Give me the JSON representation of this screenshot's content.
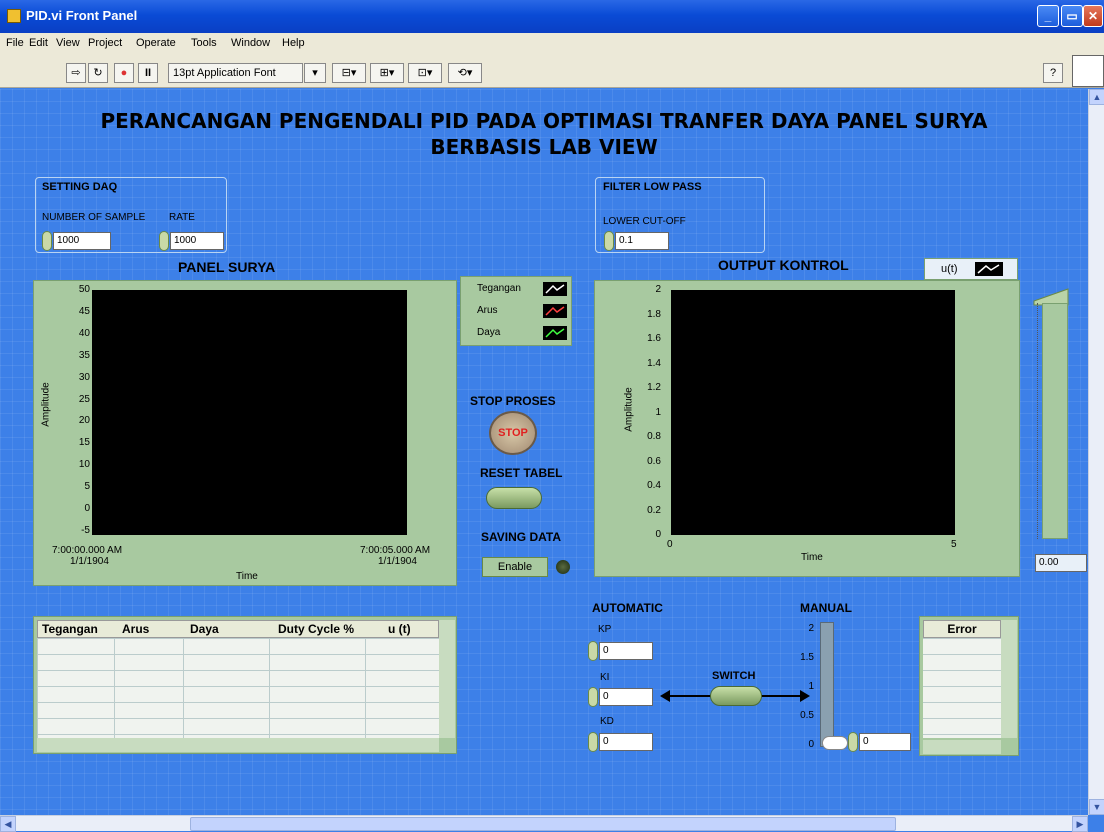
{
  "window": {
    "title": "PID.vi Front Panel"
  },
  "menu": [
    "File",
    "Edit",
    "View",
    "Project",
    "Operate",
    "Tools",
    "Window",
    "Help"
  ],
  "toolbar": {
    "font_select": "13pt Application Font"
  },
  "heading": {
    "line1": "PERANCANGAN PENGENDALI PID PADA OPTIMASI TRANFER DAYA PANEL SURYA",
    "line2": "BERBASIS LAB VIEW"
  },
  "setting_daq": {
    "title": "SETTING DAQ",
    "sample_label": "NUMBER OF SAMPLE",
    "sample_value": "1000",
    "rate_label": "RATE",
    "rate_value": "1000"
  },
  "filter": {
    "title": "FILTER LOW PASS",
    "cutoff_label": "LOWER CUT-OFF",
    "cutoff_value": "0.1"
  },
  "panel_graph": {
    "title": "PANEL SURYA",
    "ylabel": "Amplitude",
    "xlabel": "Time",
    "y_ticks": [
      "50",
      "45",
      "40",
      "35",
      "30",
      "25",
      "20",
      "15",
      "10",
      "5",
      "0",
      "-5"
    ],
    "x_start": "7:00:00.000 AM",
    "x_start_date": "1/1/1904",
    "x_end": "7:00:05.000 AM",
    "x_end_date": "1/1/1904"
  },
  "legend": [
    "Tegangan",
    "Arus",
    "Daya"
  ],
  "colors": {
    "tegangan": "#ffffff",
    "arus": "#ff4040",
    "daya": "#40ff40"
  },
  "output_graph": {
    "title": "OUTPUT KONTROL",
    "legend": "u(t)",
    "ylabel": "Amplitude",
    "xlabel": "Time",
    "y_ticks": [
      "2",
      "1.8",
      "1.6",
      "1.4",
      "1.2",
      "1",
      "0.8",
      "0.6",
      "0.4",
      "0.2",
      "0"
    ],
    "x_ticks": [
      "0",
      "5"
    ]
  },
  "slider": {
    "value": "0.00"
  },
  "controls": {
    "stop_label": "STOP PROSES",
    "stop_text": "STOP",
    "reset_label": "RESET TABEL",
    "saving_label": "SAVING DATA",
    "enable_text": "Enable"
  },
  "table": {
    "headers": [
      "Tegangan",
      "Arus",
      "Daya",
      "Duty Cycle %",
      "u (t)"
    ]
  },
  "pid": {
    "auto_label": "AUTOMATIC",
    "kp_label": "KP",
    "kp_value": "0",
    "ki_label": "KI",
    "ki_value": "0",
    "kd_label": "KD",
    "kd_value": "0",
    "switch_label": "SWITCH"
  },
  "manual": {
    "label": "MANUAL",
    "ticks": [
      "2",
      "1.5",
      "1",
      "0.5",
      "0"
    ],
    "value": "0"
  },
  "error": {
    "header": "Error"
  }
}
